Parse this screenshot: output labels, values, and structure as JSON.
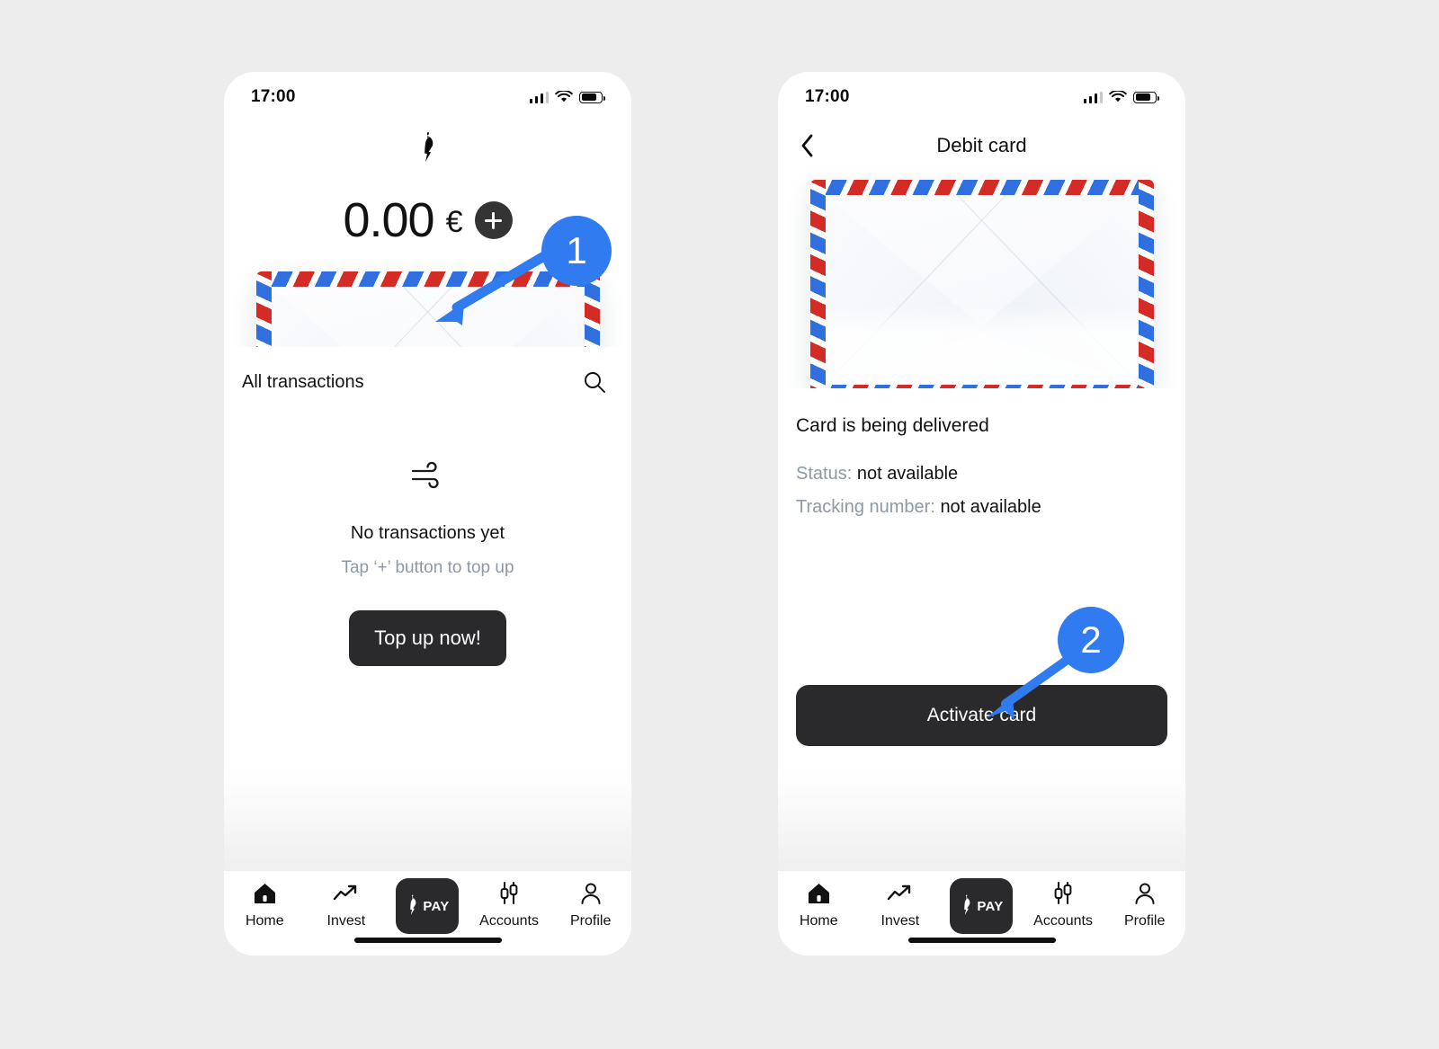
{
  "meta": {
    "accent_blue": "#2F7BEF",
    "dark_button": "#2A2A2C",
    "muted_text": "#8D98A8",
    "page_background": "#EDEDED",
    "stripe_red": "#D52B27",
    "stripe_blue": "#2F6FE0"
  },
  "status_bar": {
    "time": "17:00",
    "signal_icon": "cellular-signal-icon",
    "wifi_icon": "wifi-icon",
    "battery_icon": "battery-icon"
  },
  "screen_one": {
    "logo_icon": "chili-bolt-logo",
    "balance": {
      "amount": "0.00",
      "currency": "€",
      "add_button_icon": "plus-icon"
    },
    "envelope_icon": "airmail-envelope-illustration",
    "sheet": {
      "title": "All transactions",
      "search_icon": "search-icon",
      "empty": {
        "icon": "wind-icon",
        "title": "No transactions yet",
        "subtitle": "Tap ‘+’ button to top up",
        "cta_label": "Top up now!"
      }
    }
  },
  "screen_two": {
    "back_icon": "chevron-left-icon",
    "title": "Debit card",
    "envelope_icon": "airmail-envelope-illustration",
    "card": {
      "status_title": "Card is being delivered",
      "rows": [
        {
          "label": "Status:",
          "value": "not available"
        },
        {
          "label": "Tracking number:",
          "value": "not available"
        }
      ],
      "activate_label": "Activate card"
    }
  },
  "tabbar": {
    "items": [
      {
        "label": "Home",
        "icon": "home-icon"
      },
      {
        "label": "Invest",
        "icon": "trending-up-icon"
      },
      {
        "label": "PAY",
        "icon": "bolt-icon"
      },
      {
        "label": "Accounts",
        "icon": "candlestick-chart-icon"
      },
      {
        "label": "Profile",
        "icon": "person-icon"
      }
    ]
  },
  "callouts": [
    {
      "number": "1",
      "target": "airmail-envelope-illustration"
    },
    {
      "number": "2",
      "target": "activate-card-button"
    }
  ]
}
